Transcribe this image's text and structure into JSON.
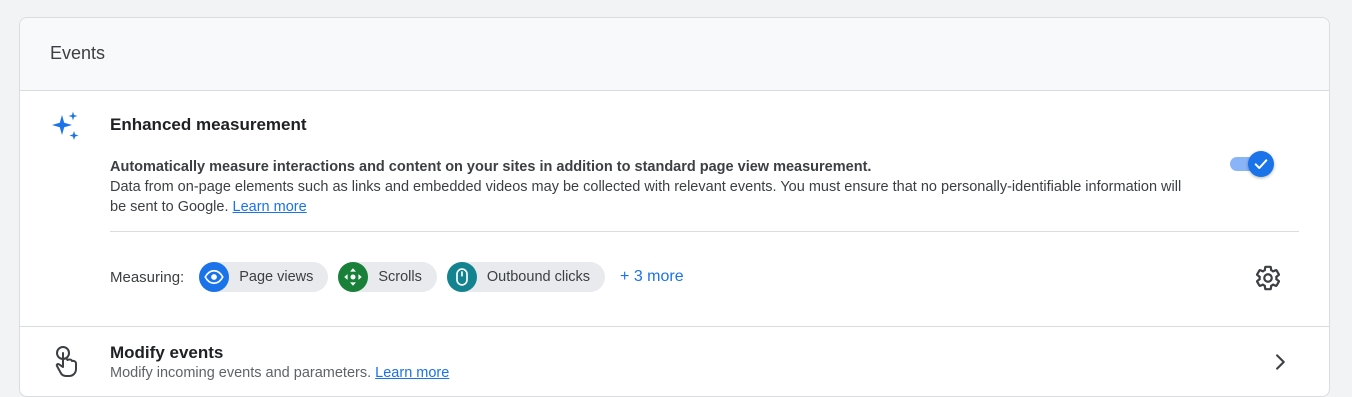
{
  "card": {
    "title": "Events"
  },
  "enhanced_measurement": {
    "title": "Enhanced measurement",
    "description_bold": "Automatically measure interactions and content on your sites in addition to standard page view measurement.",
    "description": "Data from on-page elements such as links and embedded videos may be collected with relevant events. You must ensure that no personally-identifiable information will be sent to Google.",
    "learn_more": "Learn more",
    "toggle_on": true,
    "measuring_label": "Measuring:",
    "chips": [
      {
        "label": "Page views",
        "icon": "eye-icon",
        "color": "#1a73e8"
      },
      {
        "label": "Scrolls",
        "icon": "scroll-arrows-icon",
        "color": "#188038"
      },
      {
        "label": "Outbound clicks",
        "icon": "mouse-icon",
        "color": "#12838f"
      }
    ],
    "more_link": "+ 3 more",
    "settings_icon": "gear-icon"
  },
  "modify_events": {
    "title": "Modify events",
    "description": "Modify incoming events and parameters.",
    "learn_more": "Learn more",
    "icon": "touch-icon",
    "chevron_icon": "chevron-right-icon"
  },
  "colors": {
    "accent": "#1a73e8",
    "toggle_track": "#8ab4f8",
    "page_bg": "#f1f3f4",
    "header_bg": "#f8f9fa",
    "chip_bg": "#e8eaed"
  }
}
